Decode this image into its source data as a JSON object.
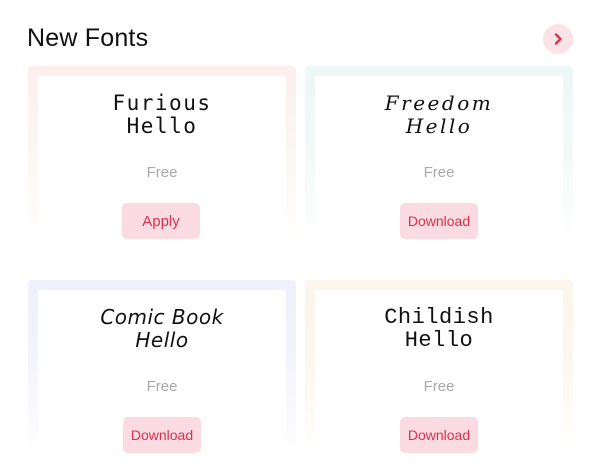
{
  "header": {
    "title": "New Fonts",
    "more_icon": "chevron-right-icon",
    "accent_color": "#d8334c"
  },
  "fonts": [
    {
      "preview": "Furious\nHello",
      "price": "Free",
      "action": "Apply"
    },
    {
      "preview": "Freedom\nHello",
      "price": "Free",
      "action": "Download"
    },
    {
      "preview": "Comic Book\nHello",
      "price": "Free",
      "action": "Download"
    },
    {
      "preview": "Childish\nHello",
      "price": "Free",
      "action": "Download"
    }
  ]
}
